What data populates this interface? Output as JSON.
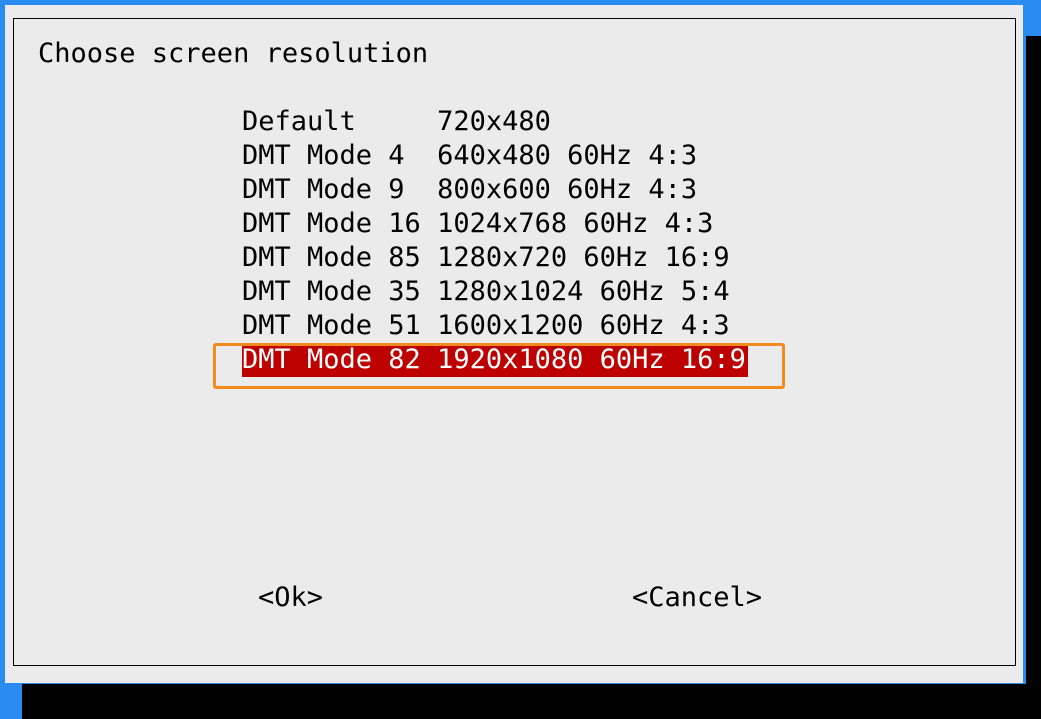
{
  "dialog": {
    "title": "Choose screen resolution",
    "items": [
      {
        "label": "Default     720x480"
      },
      {
        "label": "DMT Mode 4  640x480 60Hz 4:3"
      },
      {
        "label": "DMT Mode 9  800x600 60Hz 4:3"
      },
      {
        "label": "DMT Mode 16 1024x768 60Hz 4:3"
      },
      {
        "label": "DMT Mode 85 1280x720 60Hz 16:9"
      },
      {
        "label": "DMT Mode 35 1280x1024 60Hz 5:4"
      },
      {
        "label": "DMT Mode 51 1600x1200 60Hz 4:3"
      },
      {
        "label": "DMT Mode 82 1920x1080 60Hz 16:9"
      }
    ],
    "selected_index": 7,
    "ok_label": "<Ok>",
    "cancel_label": "<Cancel>"
  },
  "colors": {
    "background": "#2a8cf0",
    "dialog_bg": "#ebebeb",
    "selected_bg": "#bd0000",
    "selected_fg": "#ffffff",
    "highlight_outline": "#f58a1f"
  }
}
